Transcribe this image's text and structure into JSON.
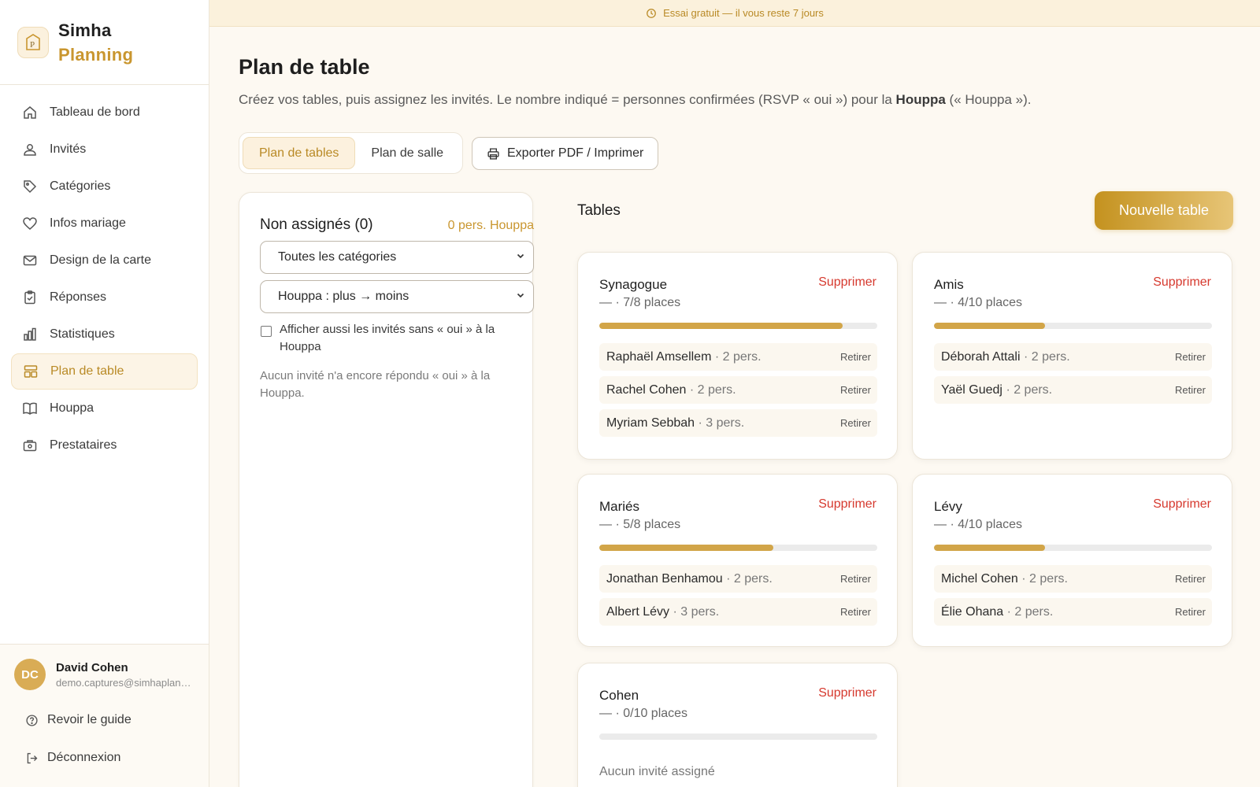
{
  "brand": {
    "line1": "Simha",
    "line2": "Planning"
  },
  "nav": [
    {
      "label": "Tableau de bord",
      "icon": "home-icon"
    },
    {
      "label": "Invités",
      "icon": "users-icon"
    },
    {
      "label": "Catégories",
      "icon": "tag-icon"
    },
    {
      "label": "Infos mariage",
      "icon": "heart-icon"
    },
    {
      "label": "Design de la carte",
      "icon": "mail-icon"
    },
    {
      "label": "Réponses",
      "icon": "clipboard-icon"
    },
    {
      "label": "Statistiques",
      "icon": "bar-chart-icon"
    },
    {
      "label": "Plan de table",
      "icon": "layout-icon",
      "active": true
    },
    {
      "label": "Houppa",
      "icon": "book-icon"
    },
    {
      "label": "Prestataires",
      "icon": "briefcase-icon"
    }
  ],
  "user": {
    "initials": "DC",
    "name": "David Cohen",
    "email": "demo.captures@simhaplanning.com"
  },
  "footer": {
    "guide": "Revoir le guide",
    "logout": "Déconnexion"
  },
  "trial": "Essai gratuit — il vous reste 7 jours",
  "page": {
    "title": "Plan de table",
    "subtitle_pre": "Créez vos tables, puis assignez les invités. Le nombre indiqué = personnes confirmées (RSVP « oui ») pour la ",
    "subtitle_bold": "Houppa",
    "subtitle_post": " (« Houppa »)."
  },
  "toolbar": {
    "tab1": "Plan de tables",
    "tab2": "Plan de salle",
    "export": "Exporter PDF / Imprimer"
  },
  "unassigned": {
    "title": "Non assignés (0)",
    "count": "0 pers. Houppa",
    "category_select": "Toutes les catégories",
    "sort_select": "Houppa : plus → moins",
    "checkbox_label": "Afficher aussi les invités sans « oui » à la Houppa",
    "empty": "Aucun invité n'a encore répondu « oui » à la Houppa."
  },
  "tables": {
    "title": "Tables",
    "new_button": "Nouvelle table",
    "delete_label": "Supprimer",
    "remove_label": "Retirer",
    "empty_label": "Aucun invité assigné",
    "items": [
      {
        "name": "Synagogue",
        "places": "— · 7/8 places",
        "fill": 0.875,
        "guests": [
          {
            "name": "Raphaël Amsellem",
            "pers": "· 2 pers."
          },
          {
            "name": "Rachel Cohen",
            "pers": "· 2 pers."
          },
          {
            "name": "Myriam Sebbah",
            "pers": "· 3 pers."
          }
        ]
      },
      {
        "name": "Amis",
        "places": "— · 4/10 places",
        "fill": 0.4,
        "guests": [
          {
            "name": "Déborah Attali",
            "pers": "· 2 pers."
          },
          {
            "name": "Yaël Guedj",
            "pers": "· 2 pers."
          }
        ]
      },
      {
        "name": "Mariés",
        "places": "— · 5/8 places",
        "fill": 0.625,
        "guests": [
          {
            "name": "Jonathan Benhamou",
            "pers": "· 2 pers."
          },
          {
            "name": "Albert Lévy",
            "pers": "· 3 pers."
          }
        ]
      },
      {
        "name": "Lévy",
        "places": "— · 4/10 places",
        "fill": 0.4,
        "guests": [
          {
            "name": "Michel Cohen",
            "pers": "· 2 pers."
          },
          {
            "name": "Élie Ohana",
            "pers": "· 2 pers."
          }
        ]
      },
      {
        "name": "Cohen",
        "places": "— · 0/10 places",
        "fill": 0,
        "guests": []
      }
    ]
  },
  "colors": {
    "accent": "#c9962f",
    "danger": "#d6392e",
    "bar": "#d2a548"
  }
}
